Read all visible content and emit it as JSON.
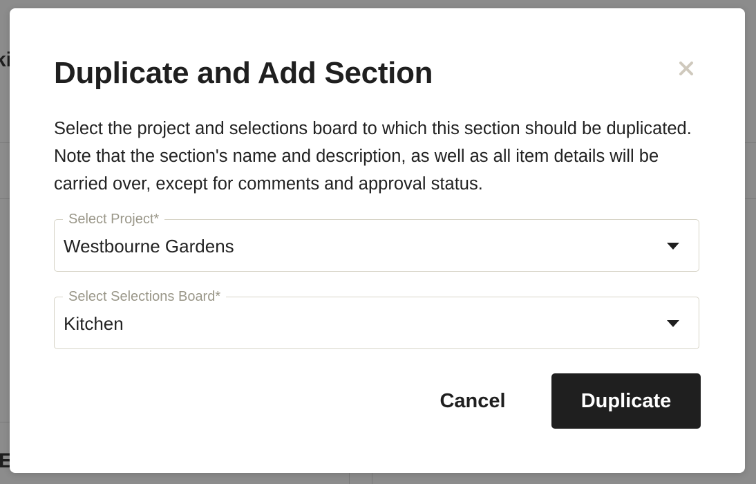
{
  "background": {
    "partial_text_top": "ki",
    "partial_text_bottom": "E"
  },
  "modal": {
    "title": "Duplicate and Add Section",
    "description": "Select the project and selections board to which this section should be duplicated. Note that the section's name and description, as well as all item details will be carried over, except for comments and approval status.",
    "close_icon": "close-icon",
    "fields": {
      "project": {
        "label": "Select Project*",
        "value": "Westbourne Gardens"
      },
      "board": {
        "label": "Select Selections Board*",
        "value": "Kitchen"
      }
    },
    "actions": {
      "cancel_label": "Cancel",
      "primary_label": "Duplicate"
    }
  },
  "colors": {
    "overlay": "#8c8c8c",
    "primary_button": "#1f1f1f",
    "field_border": "#d6d3c6",
    "field_label": "#9a9789",
    "close_icon": "#cfc9bd"
  }
}
